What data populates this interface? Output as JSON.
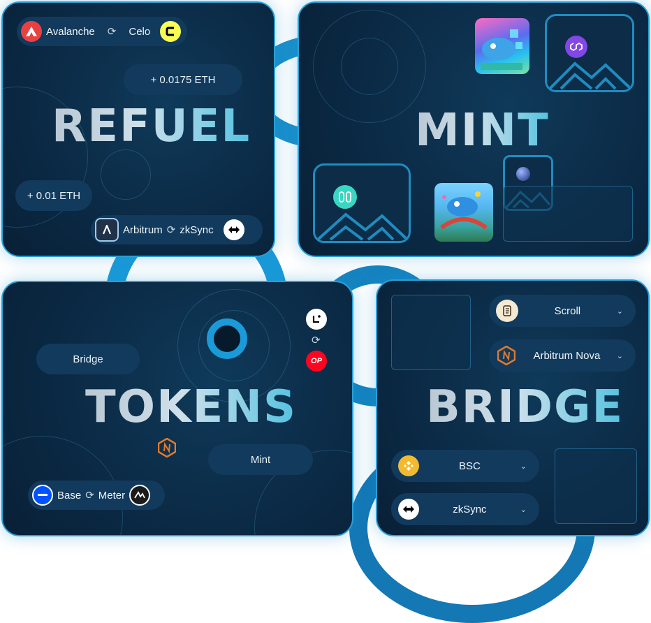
{
  "refuel": {
    "title": "REFUEL",
    "amount_top": "+ 0.0175 ETH",
    "amount_bottom": "+ 0.01 ETH",
    "route_top": {
      "from": "Avalanche",
      "to": "Celo"
    },
    "route_bottom": {
      "from": "Arbitrum",
      "to": "zkSync"
    }
  },
  "mint": {
    "title": "MINT"
  },
  "tokens": {
    "title": "TOKENS",
    "bridge_label": "Bridge",
    "mint_label": "Mint",
    "route": {
      "from": "Base",
      "to": "Meter"
    }
  },
  "bridge": {
    "title": "BRIDGE",
    "dropdowns_top": [
      "Scroll",
      "Arbitrum Nova"
    ],
    "dropdowns_bottom": [
      "BSC",
      "zkSync"
    ]
  },
  "colors": {
    "card_bg": "#0b2a45",
    "accent": "#2a9fd6",
    "tube": "#1a9ad8",
    "pill_bg": "#123a5c"
  },
  "icons": {
    "swap": "swap-icon",
    "chevron": "chevron-down-icon",
    "image_placeholder": "image-placeholder-icon"
  }
}
